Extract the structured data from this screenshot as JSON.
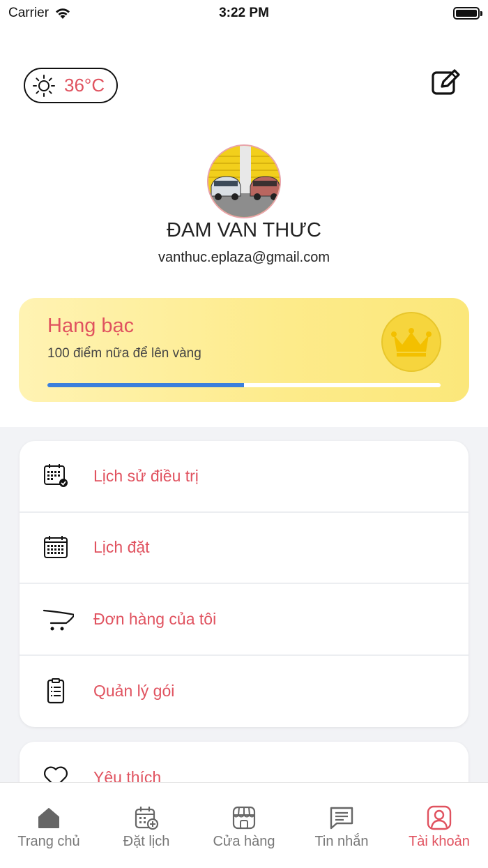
{
  "status_bar": {
    "carrier": "Carrier",
    "time": "3:22 PM"
  },
  "weather": {
    "temperature": "36°C",
    "icon": "sun-icon"
  },
  "header": {
    "edit_icon": "edit-icon"
  },
  "profile": {
    "name": "ĐAM VAN THƯC",
    "email": "vanthuc.eplaza@gmail.com"
  },
  "rank": {
    "title": "Hạng bạc",
    "subtitle": "100 điểm nữa để lên vàng",
    "progress": 0.5,
    "badge_icon": "crown-icon",
    "colors": {
      "progress": "#3b7fdc",
      "badge": "#f6d53d"
    }
  },
  "menu": {
    "items": [
      {
        "label": "Lịch sử điều trị",
        "icon": "calendar-check-icon"
      },
      {
        "label": "Lịch đặt",
        "icon": "calendar-icon"
      },
      {
        "label": "Đơn hàng của tôi",
        "icon": "cart-icon"
      },
      {
        "label": "Quản lý gói",
        "icon": "clipboard-icon"
      }
    ],
    "extra_items": [
      {
        "label": "Yêu thích",
        "icon": "heart-icon"
      }
    ]
  },
  "tabs": [
    {
      "label": "Trang chủ",
      "icon": "home-icon",
      "active": false
    },
    {
      "label": "Đặt lịch",
      "icon": "calendar-add-icon",
      "active": false
    },
    {
      "label": "Cửa hàng",
      "icon": "store-icon",
      "active": false
    },
    {
      "label": "Tin nhắn",
      "icon": "message-icon",
      "active": false
    },
    {
      "label": "Tài khoản",
      "icon": "account-icon",
      "active": true
    }
  ],
  "colors": {
    "accent": "#e0525f",
    "inactive": "#777777"
  }
}
